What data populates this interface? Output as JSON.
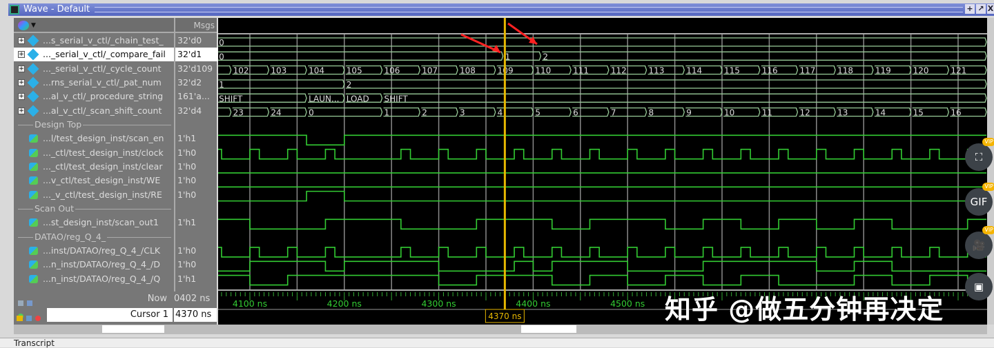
{
  "window": {
    "title": "Wave - Default",
    "buttons": [
      "+",
      "↗",
      "X"
    ]
  },
  "header": {
    "msgs": "Msgs"
  },
  "rows": [
    {
      "kind": "bus",
      "name": "...s_serial_v_ctl/_chain_test_",
      "value": "32'd0"
    },
    {
      "kind": "bus",
      "name": "..._serial_v_ctl/_compare_fail",
      "value": "32'd1",
      "selected": true
    },
    {
      "kind": "bus",
      "name": "..._serial_v_ctl/_cycle_count",
      "value": "32'd109"
    },
    {
      "kind": "bus",
      "name": "...rns_serial_v_ctl/_pat_num",
      "value": "32'd2"
    },
    {
      "kind": "bus",
      "name": "...al_v_ctl/_procedure_string",
      "value": "161'a..."
    },
    {
      "kind": "bus",
      "name": "...al_v_ctl/_scan_shift_count",
      "value": "32'd4"
    },
    {
      "kind": "divider",
      "name": "Design Top"
    },
    {
      "kind": "bit",
      "name": "...l/test_design_inst/scan_en",
      "value": "1'h1"
    },
    {
      "kind": "bit",
      "name": "..._ctl/test_design_inst/clock",
      "value": "1'h0"
    },
    {
      "kind": "bit",
      "name": "..._ctl/test_design_inst/clear",
      "value": "1'h0"
    },
    {
      "kind": "bit",
      "name": "...v_ctl/test_design_inst/WE",
      "value": "1'h0"
    },
    {
      "kind": "bit",
      "name": "..._v_ctl/test_design_inst/RE",
      "value": "1'h0"
    },
    {
      "kind": "divider",
      "name": "Scan Out"
    },
    {
      "kind": "bit",
      "name": "...st_design_inst/scan_out1",
      "value": "1'h1",
      "out": true
    },
    {
      "kind": "divider",
      "name": "DATAO/reg_Q_4_"
    },
    {
      "kind": "bit",
      "name": "...inst/DATAO/reg_Q_4_/CLK",
      "value": "1'h0"
    },
    {
      "kind": "bit",
      "name": "...n_inst/DATAO/reg_Q_4_/D",
      "value": "1'h0"
    },
    {
      "kind": "bit",
      "name": "...n_inst/DATAO/reg_Q_4_/Q",
      "value": "1'h1",
      "out": true
    }
  ],
  "waves": {
    "time_range_ns": [
      4065,
      4880
    ],
    "buses": {
      "0": [
        [
          4065,
          "0"
        ]
      ],
      "1": [
        [
          4065,
          "0"
        ],
        [
          4368,
          "1"
        ],
        [
          4408,
          "2"
        ]
      ],
      "2": [
        [
          4065,
          ""
        ],
        [
          4080,
          "102"
        ],
        [
          4120,
          "103"
        ],
        [
          4160,
          "104"
        ],
        [
          4200,
          "105"
        ],
        [
          4240,
          "106"
        ],
        [
          4280,
          "107"
        ],
        [
          4320,
          "108"
        ],
        [
          4360,
          "109"
        ],
        [
          4400,
          "110"
        ],
        [
          4440,
          "111"
        ],
        [
          4480,
          "112"
        ],
        [
          4520,
          "113"
        ],
        [
          4560,
          "114"
        ],
        [
          4600,
          "115"
        ],
        [
          4640,
          "116"
        ],
        [
          4680,
          "117"
        ],
        [
          4720,
          "118"
        ],
        [
          4760,
          "119"
        ],
        [
          4800,
          "120"
        ],
        [
          4840,
          "121"
        ]
      ],
      "3": [
        [
          4065,
          "1"
        ],
        [
          4200,
          "2"
        ]
      ],
      "4": [
        [
          4065,
          "SHIFT"
        ],
        [
          4160,
          "LAUN..."
        ],
        [
          4200,
          "LOAD"
        ],
        [
          4240,
          "SHIFT"
        ]
      ],
      "5": [
        [
          4065,
          ""
        ],
        [
          4080,
          "23"
        ],
        [
          4120,
          "24"
        ],
        [
          4160,
          "0"
        ],
        [
          4240,
          "1"
        ],
        [
          4280,
          "2"
        ],
        [
          4320,
          "3"
        ],
        [
          4360,
          "4"
        ],
        [
          4400,
          "5"
        ],
        [
          4440,
          "6"
        ],
        [
          4480,
          "7"
        ],
        [
          4520,
          "8"
        ],
        [
          4560,
          "9"
        ],
        [
          4600,
          "10"
        ],
        [
          4640,
          "11"
        ],
        [
          4680,
          "12"
        ],
        [
          4720,
          "13"
        ],
        [
          4760,
          "14"
        ],
        [
          4800,
          "15"
        ],
        [
          4840,
          "16"
        ]
      ]
    },
    "bits": {
      "7": {
        "init": 1,
        "edges": [
          4160,
          4200
        ]
      },
      "8": {
        "clock": true,
        "skip": [
          4220
        ]
      },
      "9": {
        "init": 0,
        "edges": []
      },
      "10": {
        "init": 0,
        "edges": []
      },
      "11": {
        "init": 0,
        "edges": [
          4160,
          4200
        ]
      },
      "13": {
        "init": 1,
        "edges": [
          4100,
          4180,
          4260,
          4340,
          4420,
          4460,
          4540,
          4580,
          4620,
          4660,
          4700,
          4740,
          4780,
          4860
        ]
      },
      "15": {
        "clock": true,
        "skip": [
          4220
        ]
      },
      "16": {
        "init": 0,
        "edges": [
          4100,
          4180,
          4200,
          4300,
          4380,
          4400,
          4420,
          4500,
          4580,
          4700,
          4740,
          4780
        ]
      },
      "17": {
        "init": 1,
        "edges": [
          4100,
          4140,
          4300,
          4340,
          4420,
          4460,
          4500,
          4540,
          4580,
          4620,
          4660,
          4740,
          4780,
          4820,
          4860
        ]
      }
    },
    "cursor_ns": 4370
  },
  "footer": {
    "now_label": "Now",
    "now_value": "0402 ns",
    "cursor_label": "Cursor 1",
    "cursor_value": "4370 ns",
    "cursor_time_box": "4370 ns",
    "ticks": [
      "4100 ns",
      "4200 ns",
      "4300 ns",
      "4400 ns",
      "4500 ns"
    ]
  },
  "transcript": {
    "label": "Transcript"
  },
  "overlay": {
    "watermark": "知乎 @做五分钟再决定",
    "buttons": [
      {
        "label": "",
        "badge": "VIP"
      },
      {
        "label": "GIF",
        "badge": "VIP"
      },
      {
        "label": "",
        "badge": "VIP"
      },
      {
        "label": ""
      }
    ]
  },
  "colors": {
    "wave": "#33cc33",
    "cursor": "#e8b800",
    "grid": "#8a8a8a",
    "bus_text": "#dddddd"
  }
}
